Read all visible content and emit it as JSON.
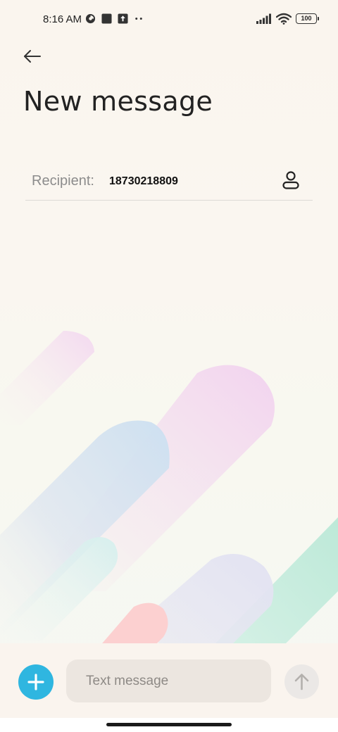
{
  "status_bar": {
    "time": "8:16 AM",
    "left_icons": [
      "data-saver-icon",
      "square-notification-icon",
      "upload-notification-icon",
      "more-dots-icon"
    ],
    "right_icons": [
      "signal-icon",
      "wifi-icon",
      "battery-icon"
    ],
    "battery_level": "100"
  },
  "header": {
    "back_icon": "arrow-left-icon",
    "title": "New message"
  },
  "recipient": {
    "label": "Recipient:",
    "value": "18730218809",
    "contact_icon": "person-icon"
  },
  "composer": {
    "add_icon": "plus-icon",
    "placeholder": "Text message",
    "send_icon": "arrow-up-icon"
  },
  "colors": {
    "accent": "#2fb6e0",
    "background": "#faf5ee"
  }
}
